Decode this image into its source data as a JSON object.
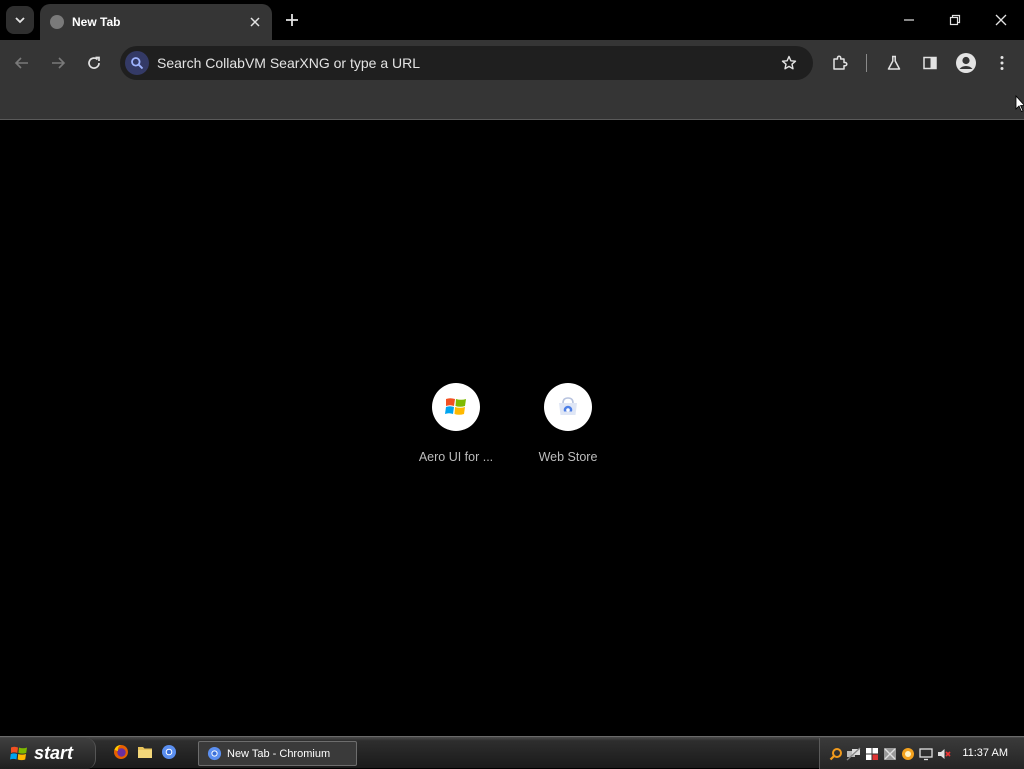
{
  "tabstrip": {
    "active_tab": {
      "title": "New Tab"
    }
  },
  "toolbar": {
    "omnibox": {
      "placeholder": "Search CollabVM SearXNG or type a URL"
    }
  },
  "shortcuts": [
    {
      "label": "Aero UI for ...",
      "icon": "windows-logo-icon"
    },
    {
      "label": "Web Store",
      "icon": "web-store-icon"
    }
  ],
  "taskbar": {
    "start_label": "start",
    "task_label": "New Tab - Chromium",
    "clock": "11:37 AM"
  },
  "colors": {
    "tabstrip_bg": "#000000",
    "toolbar_bg": "#353535",
    "omnibox_bg": "#1f1f1f",
    "content_bg": "#000000"
  }
}
